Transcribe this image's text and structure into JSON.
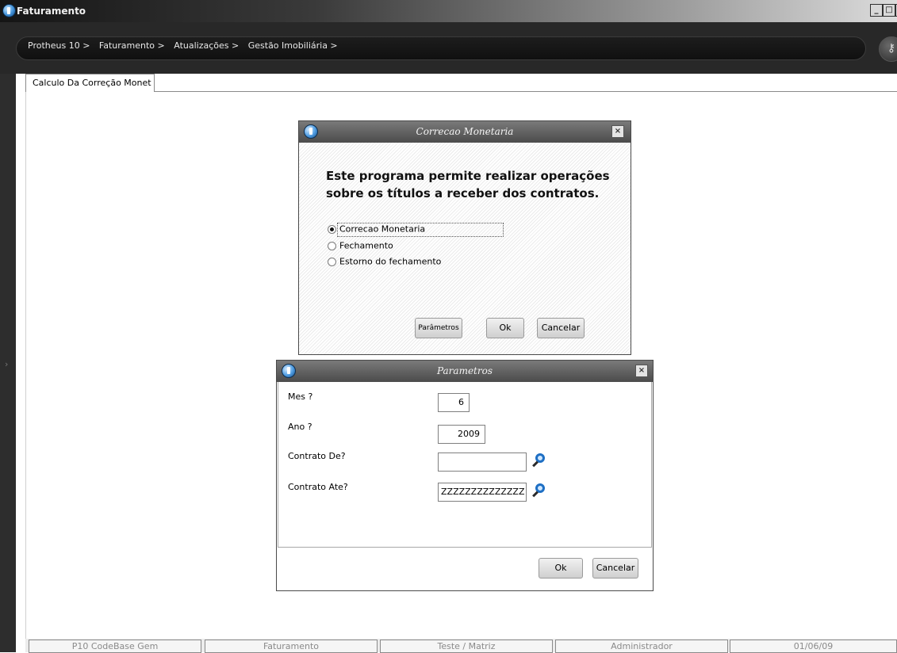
{
  "window": {
    "title": "Faturamento",
    "controls": {
      "minimize": "_",
      "restore": "□",
      "close": "×"
    }
  },
  "breadcrumb": [
    "Protheus 10 >",
    "Faturamento >",
    "Atualizações >",
    "Gestão Imobiliária >"
  ],
  "tab": {
    "label": "Calculo Da Correção Monet"
  },
  "dialog_correcao": {
    "title": "Correcao Monetaria",
    "intro_line1": "Este programa permite realizar operações",
    "intro_line2": "sobre os títulos a receber dos contratos.",
    "options": [
      {
        "label": "Correcao Monetaria",
        "selected": true
      },
      {
        "label": "Fechamento",
        "selected": false
      },
      {
        "label": "Estorno do fechamento",
        "selected": false
      }
    ],
    "buttons": {
      "params": "Parâmetros",
      "ok": "Ok",
      "cancel": "Cancelar"
    }
  },
  "dialog_parametros": {
    "title": "Parametros",
    "fields": [
      {
        "label": "Mes ?",
        "value": "6"
      },
      {
        "label": "Ano ?",
        "value": "2009"
      },
      {
        "label": "Contrato De?",
        "value": ""
      },
      {
        "label": "Contrato Ate?",
        "value": "ZZZZZZZZZZZZZZ"
      }
    ],
    "buttons": {
      "ok": "Ok",
      "cancel": "Cancelar"
    }
  },
  "statusbar": [
    "P10 CodeBase Gem",
    "Faturamento",
    "Teste / Matriz",
    "Administrador",
    "01/06/09"
  ],
  "icons": {
    "app": "totvs-logo-icon",
    "key": "key-icon",
    "lookup": "magnifier-icon"
  }
}
